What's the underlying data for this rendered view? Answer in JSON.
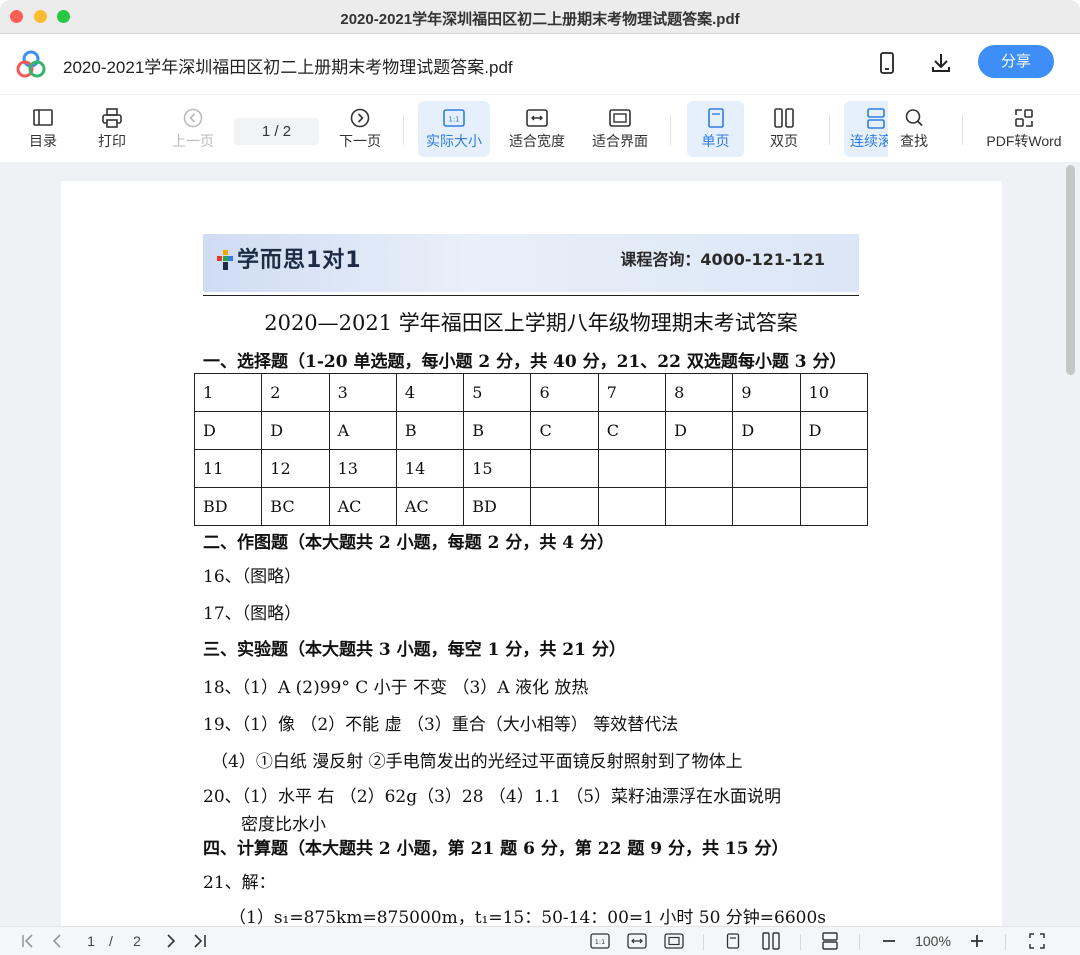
{
  "window": {
    "title": "2020-2021学年深圳福田区初二上册期末考物理试题答案.pdf"
  },
  "header": {
    "doc_title": "2020-2021学年深圳福田区初二上册期末考物理试题答案.pdf",
    "share_label": "分享",
    "icons": [
      "phone-icon",
      "download-icon"
    ]
  },
  "toolbar": {
    "toc": "目录",
    "print": "打印",
    "prev": "上一页",
    "page_indicator": "1  /  2",
    "next": "下一页",
    "actual_size": "实际大小",
    "fit_width": "适合宽度",
    "fit_page": "适合界面",
    "single": "单页",
    "double": "双页",
    "continuous": "连续滚",
    "find": "查找",
    "pdf_to_word": "PDF转Word"
  },
  "document": {
    "brand": "学而思1对1",
    "consult": "课程咨询：4000-121-121",
    "title": "2020—2021 学年福田区上学期八年级物理期末考试答案",
    "sec1": "一、选择题（1-20 单选题，每小题 2 分，共 40 分，21、22 双选题每小题 3 分）",
    "table": [
      [
        "1",
        "2",
        "3",
        "4",
        "5",
        "6",
        "7",
        "8",
        "9",
        "10"
      ],
      [
        "D",
        "D",
        "A",
        "B",
        "B",
        "C",
        "C",
        "D",
        "D",
        "D"
      ],
      [
        "11",
        "12",
        "13",
        "14",
        "15",
        "",
        "",
        "",
        "",
        ""
      ],
      [
        "BD",
        "BC",
        "AC",
        "AC",
        "BD",
        "",
        "",
        "",
        "",
        ""
      ]
    ],
    "sec2": "二、作图题（本大题共 2 小题，每题 2 分，共 4 分）",
    "l16": "16、（图略）",
    "l17": "17、（图略）",
    "sec3": "三、实验题（本大题共  3  小题，每空 1 分，共 21 分）",
    "l18": "18、（1）A   (2)99° C  小于  不变   （3）A    液化  放热",
    "l19": "19、（1）像    （2）不能   虚   （3）重合（大小相等）   等效替代法",
    "l19b": "（4）①白纸    漫反射   ②手电筒发出的光经过平面镜反射照射到了物体上",
    "l20": "20、（1）水平  右   （2）62g（3）28   （4）1.1  （5）菜籽油漂浮在水面说明",
    "l20b": "密度比水小",
    "sec4": "四、计算题（本大题共 2 小题，第 21 题 6 分，第 22 题 9 分，共 15 分）",
    "l21": "21、解：",
    "l21a": "（1）s₁=875km=875000m，t₁=15：50-14：00=1 小时 50 分钟=6600s"
  },
  "statusbar": {
    "page": "1",
    "total": "2",
    "zoom": "100%"
  }
}
